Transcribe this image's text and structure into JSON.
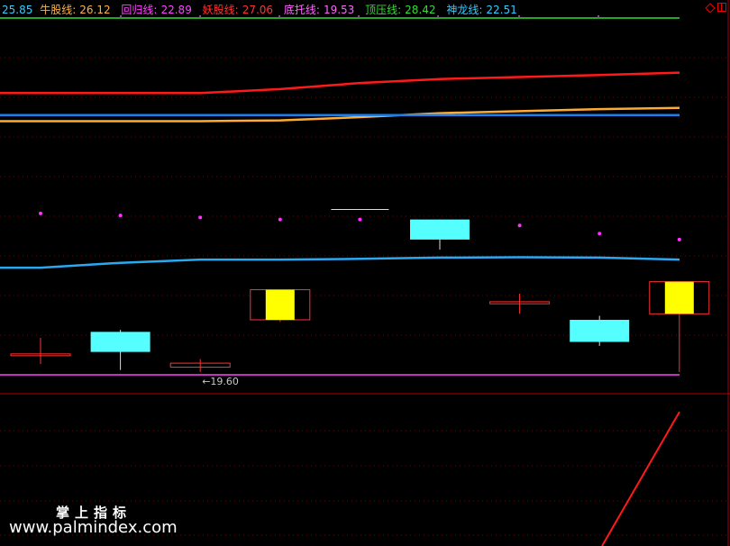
{
  "legend": {
    "price": "25.85",
    "items": [
      {
        "label": "牛股线:",
        "value": "26.12",
        "color": "#ffb347"
      },
      {
        "label": "回归线:",
        "value": "22.89",
        "color": "#ff44ff"
      },
      {
        "label": "妖股线:",
        "value": "27.06",
        "color": "#ff3333"
      },
      {
        "label": "底托线:",
        "value": "19.53",
        "color": "#ff66ff"
      },
      {
        "label": "顶压线:",
        "value": "28.42",
        "color": "#33dd33"
      },
      {
        "label": "神龙线:",
        "value": "22.51",
        "color": "#33ccff"
      }
    ],
    "price_color": "#33ccff"
  },
  "low_marker": "←19.60",
  "watermark": {
    "title": "掌上指标",
    "url": "www.palmindex.com"
  },
  "chart_data": {
    "type": "candlestick",
    "ylim": [
      19.0,
      29.0
    ],
    "grid": true,
    "candles": [
      {
        "open": 20.05,
        "close": 20.05,
        "high": 20.45,
        "low": 19.8,
        "style": "doji"
      },
      {
        "open": 20.1,
        "close": 20.6,
        "high": 20.65,
        "low": 19.65,
        "style": "down"
      },
      {
        "open": 19.82,
        "close": 19.72,
        "high": 19.92,
        "low": 19.6,
        "style": "doji"
      },
      {
        "open": 20.9,
        "close": 21.65,
        "high": 21.65,
        "low": 20.85,
        "style": "up"
      },
      {
        "open": null,
        "close": null,
        "high": null,
        "low": null,
        "style": "none"
      },
      {
        "open": 23.4,
        "close": 22.9,
        "high": 23.4,
        "low": 22.65,
        "style": "down"
      },
      {
        "open": 21.35,
        "close": 21.3,
        "high": 21.55,
        "low": 21.05,
        "style": "doji"
      },
      {
        "open": 20.9,
        "close": 20.35,
        "high": 21.0,
        "low": 20.25,
        "style": "down"
      },
      {
        "open": 21.05,
        "close": 21.85,
        "high": 21.85,
        "low": 19.6,
        "style": "up"
      }
    ],
    "dots": [
      23.55,
      23.5,
      23.45,
      23.4,
      23.4,
      23.3,
      23.25,
      23.05,
      22.9
    ],
    "dash_mark": {
      "value": 23.65,
      "from": 4,
      "to": 4.7
    },
    "series": [
      {
        "name": "牛股线",
        "color": "#ffaa33",
        "values": [
          25.85,
          25.85,
          25.85,
          25.87,
          25.95,
          26.05,
          26.1,
          26.15,
          26.18
        ]
      },
      {
        "name": "妖股线",
        "color": "#ff1a1a",
        "values": [
          26.55,
          26.55,
          26.55,
          26.65,
          26.8,
          26.9,
          26.95,
          27.0,
          27.06
        ]
      },
      {
        "name": "顶压线",
        "color": "#33dd33",
        "values": [
          28.42,
          28.42,
          28.42,
          28.42,
          28.42,
          28.42,
          28.42,
          28.42,
          28.42
        ]
      },
      {
        "name": "底托线",
        "color": "#ff44ff",
        "values": [
          19.53,
          19.53,
          19.53,
          19.53,
          19.53,
          19.53,
          19.53,
          19.53,
          19.53
        ]
      },
      {
        "name": "神龙线",
        "color": "#2aa8f0",
        "values": [
          22.2,
          22.32,
          22.4,
          22.4,
          22.42,
          22.45,
          22.46,
          22.45,
          22.4
        ]
      },
      {
        "name": "蓝色线",
        "color": "#1e7fe6",
        "values": [
          26.0,
          26.0,
          26.0,
          26.0,
          26.0,
          26.0,
          26.0,
          26.0,
          26.0
        ]
      }
    ]
  }
}
